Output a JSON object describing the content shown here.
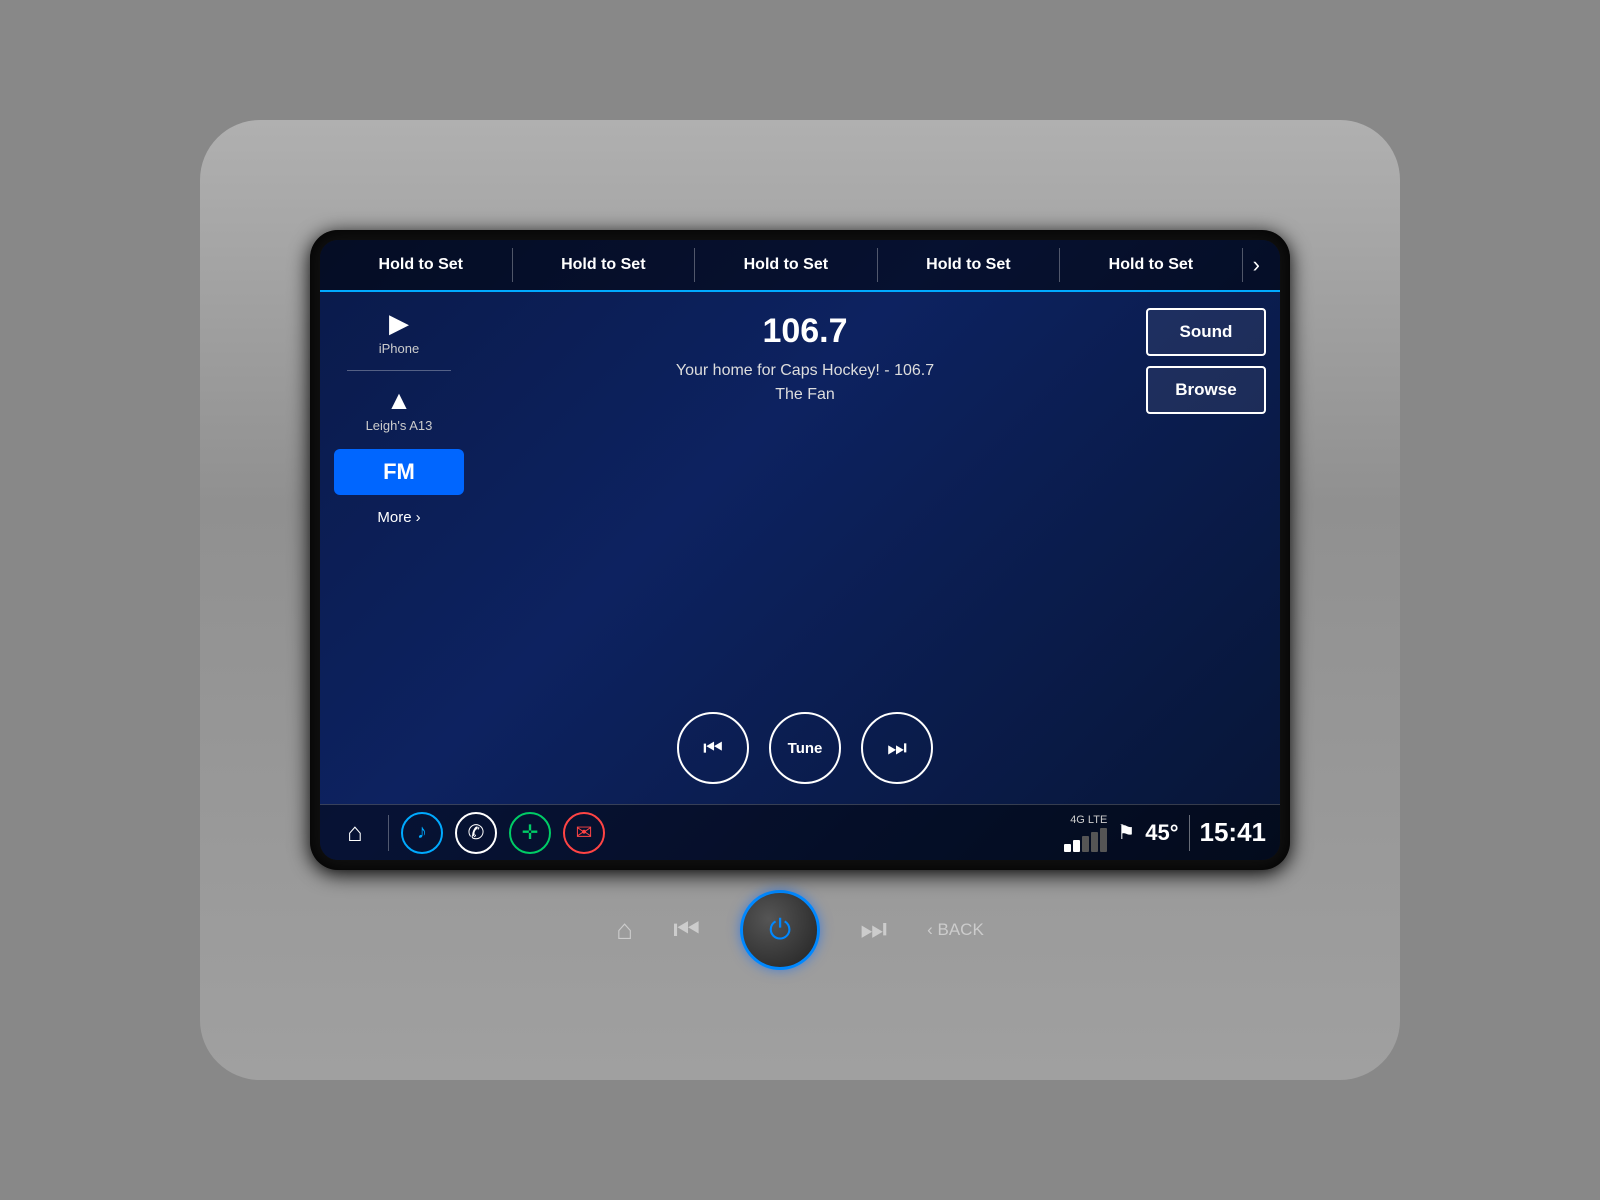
{
  "presets": {
    "items": [
      {
        "label": "Hold to Set"
      },
      {
        "label": "Hold to Set"
      },
      {
        "label": "Hold to Set"
      },
      {
        "label": "Hold to Set"
      },
      {
        "label": "Hold to Set"
      }
    ],
    "next_icon": "›"
  },
  "source": {
    "iphone_label": "iPhone",
    "carplay_label": "Leigh's A13"
  },
  "band": {
    "label": "FM"
  },
  "more_btn": {
    "label": "More",
    "icon": "›"
  },
  "station": {
    "frequency": "106.7",
    "description_line1": "Your home for Caps Hockey! - 106.7",
    "description_line2": "The Fan"
  },
  "transport": {
    "prev_icon": "⏮",
    "tune_label": "Tune",
    "next_icon": "⏭"
  },
  "right_actions": {
    "sound_label": "Sound",
    "browse_label": "Browse"
  },
  "statusbar": {
    "signal_label": "4G LTE",
    "signal_active_bars": 2,
    "signal_total_bars": 5,
    "temperature": "45°",
    "time": "15:41"
  },
  "nav": {
    "home_icon": "⌂",
    "music_icon": "♪",
    "phone_icon": "✆",
    "apps_icon": "✛",
    "nav_icon": "⚙"
  },
  "physical": {
    "home_icon": "⌂",
    "prev_icon": "⏮",
    "next_icon": "⏭",
    "back_label": "‹ BACK",
    "power_icon": "⏻"
  }
}
